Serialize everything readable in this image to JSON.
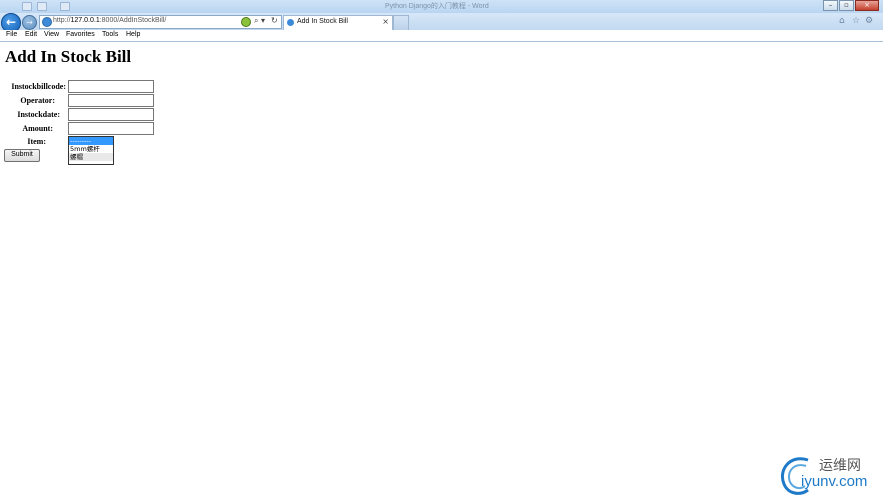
{
  "window": {
    "title": "Python Django的入门教程 - Word"
  },
  "browser": {
    "url_prefix": "http://",
    "url_host": "127.0.0.1",
    "url_rest": ":8000/AddInStockBill/",
    "tab_title": "Add In Stock Bill",
    "tab_close": "×",
    "search_glyph": "⌕ ▾",
    "refresh_glyph": "↻",
    "back_glyph": "←",
    "forward_glyph": "→"
  },
  "menu": [
    "File",
    "Edit",
    "View",
    "Favorites",
    "Tools",
    "Help"
  ],
  "page": {
    "heading": "Add In Stock Bill",
    "fields": [
      {
        "label": "Instockbillcode:",
        "value": ""
      },
      {
        "label": "Operator:",
        "value": ""
      },
      {
        "label": "Instockdate:",
        "value": ""
      },
      {
        "label": "Amount:",
        "value": ""
      }
    ],
    "item_label": "Item:",
    "item_options": [
      "---------",
      "5mm螺杆",
      "螺帽"
    ],
    "submit_label": "Submit"
  },
  "watermark": {
    "cn": "运维网",
    "en": "iyunv.com"
  },
  "colors": {
    "selected_option": "#3399ff",
    "watermark_blue": "#1e7ac8"
  }
}
